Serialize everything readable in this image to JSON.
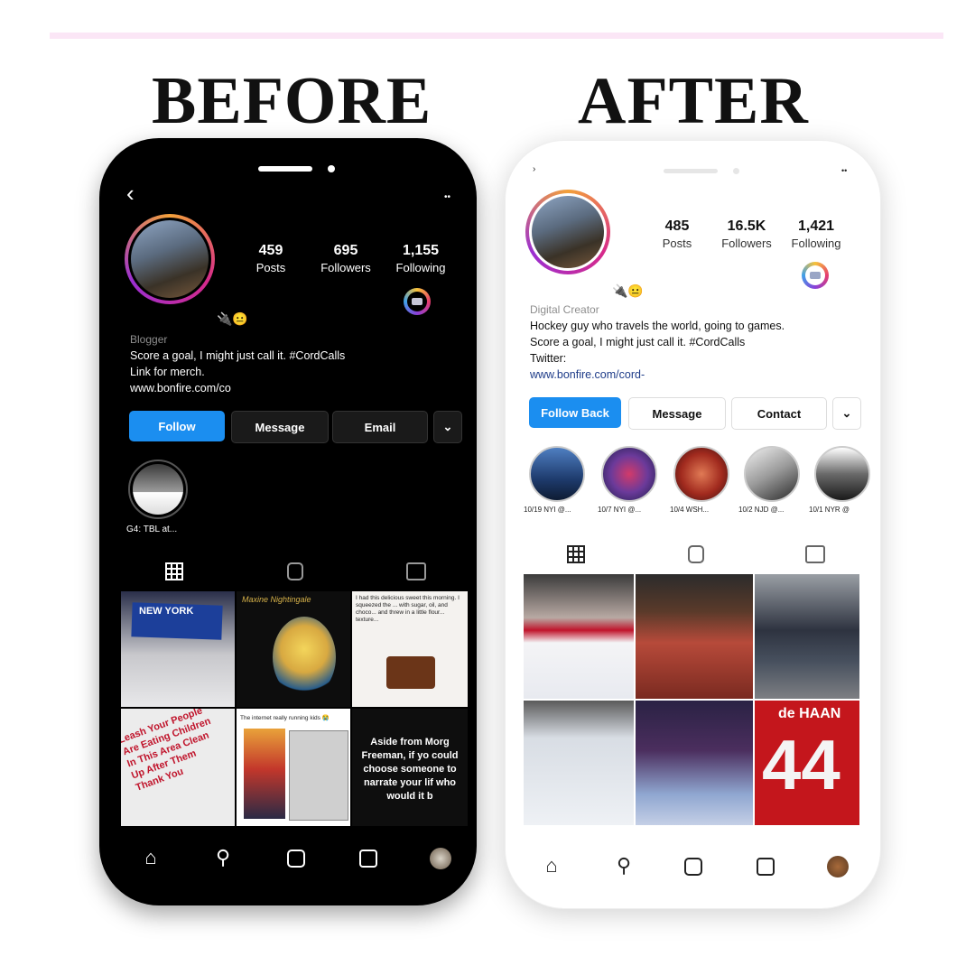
{
  "headings": {
    "before": "BEFORE",
    "after": "AFTER"
  },
  "before": {
    "stats": [
      {
        "value": "459",
        "label": "Posts"
      },
      {
        "value": "695",
        "label": "Followers"
      },
      {
        "value": "1,155",
        "label": "Following"
      }
    ],
    "emoji": "🔌😐",
    "category": "Blogger",
    "bio_lines": [
      "Score a goal, I might just call it. #CordCalls",
      "Link for merch."
    ],
    "link": "www.bonfire.com/co",
    "buttons": {
      "follow": "Follow",
      "message": "Message",
      "email": "Email",
      "more": "⌄"
    },
    "highlight_label": "G4: TBL at...",
    "grid_texts": {
      "rangers": "NEW YORK",
      "masters": "Maxine Nightingale",
      "dessert": "I had this delicious sweet this morning. I squeezed the ... with sugar, oil, and choco... and threw in a little flour... texture...",
      "sign": "Leash Your People Are Eating Children In This Area Clean Up After Them Thank You",
      "meme_caption": "The internet really running kids 😭",
      "freeman": "Aside from Morg Freeman, if yo could choose someone to narrate your lif who would it b"
    }
  },
  "after": {
    "stats": [
      {
        "value": "485",
        "label": "Posts"
      },
      {
        "value": "16.5K",
        "label": "Followers"
      },
      {
        "value": "1,421",
        "label": "Following"
      }
    ],
    "emoji": "🔌😐",
    "category": "Digital Creator",
    "bio_lines": [
      "Hockey guy who travels the world, going to games.",
      "Score a goal, I might just call it. #CordCalls",
      "Twitter:"
    ],
    "link": "www.bonfire.com/cord-",
    "buttons": {
      "follow": "Follow Back",
      "message": "Message",
      "contact": "Contact",
      "more": "⌄"
    },
    "highlights": [
      "10/19 NYI @...",
      "10/7 NYI @...",
      "10/4 WSH...",
      "10/2 NJD @...",
      "10/1 NYR @"
    ],
    "grid_texts": {
      "dehaan": "de HAAN",
      "number": "44"
    }
  },
  "colors": {
    "follow_blue": "#1b8ef0",
    "link_blue": "#1d3b88",
    "ring_pink": "#d62a8a"
  }
}
